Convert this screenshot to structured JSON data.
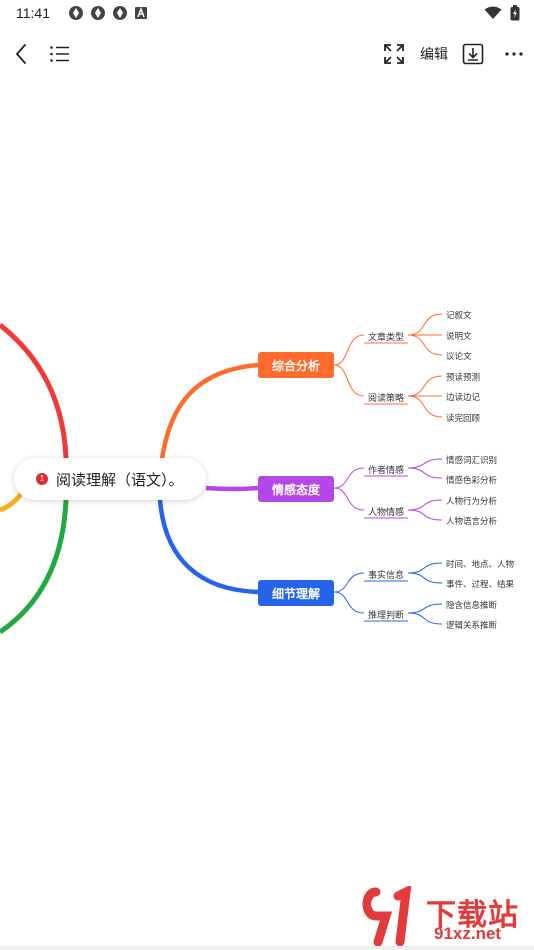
{
  "status_bar": {
    "time": "11:41",
    "left_icons": [
      "sync-icon",
      "sync-icon",
      "sync-icon",
      "a-app-icon"
    ],
    "right_icons": [
      "wifi-icon",
      "battery-charging-icon"
    ]
  },
  "toolbar": {
    "back_icon": "chevron-left-icon",
    "outline_icon": "list-icon",
    "fullscreen_icon": "fullscreen-icon",
    "edit_label": "编辑",
    "download_icon": "download-icon",
    "more_icon": "more-icon"
  },
  "mindmap": {
    "root": {
      "badge": "1",
      "text": "阅读理解（语文）。"
    },
    "branches": [
      {
        "label": "综合分析",
        "color": "#ff6b2c",
        "subs": [
          {
            "label": "文章类型",
            "leaves": [
              "记叙文",
              "说明文",
              "议论文"
            ]
          },
          {
            "label": "阅读策略",
            "leaves": [
              "预读预测",
              "边读边记",
              "读完回顾"
            ]
          }
        ]
      },
      {
        "label": "情感态度",
        "color": "#b447e8",
        "subs": [
          {
            "label": "作者情感",
            "leaves": [
              "情感词汇识别",
              "情感色彩分析"
            ]
          },
          {
            "label": "人物情感",
            "leaves": [
              "人物行为分析",
              "人物语言分析"
            ]
          }
        ]
      },
      {
        "label": "细节理解",
        "color": "#2563eb",
        "subs": [
          {
            "label": "事实信息",
            "leaves": [
              "时间、地点、人物",
              "事件、过程、结果"
            ]
          },
          {
            "label": "推理判断",
            "leaves": [
              "隐含信息推断",
              "逻辑关系推断"
            ]
          }
        ]
      }
    ],
    "left_branch_colors": [
      "#f03a3a",
      "#f5b21e",
      "#22a843"
    ]
  },
  "watermark": {
    "title": "下载站",
    "url": "91xz.net",
    "color": "#e23b3b"
  }
}
